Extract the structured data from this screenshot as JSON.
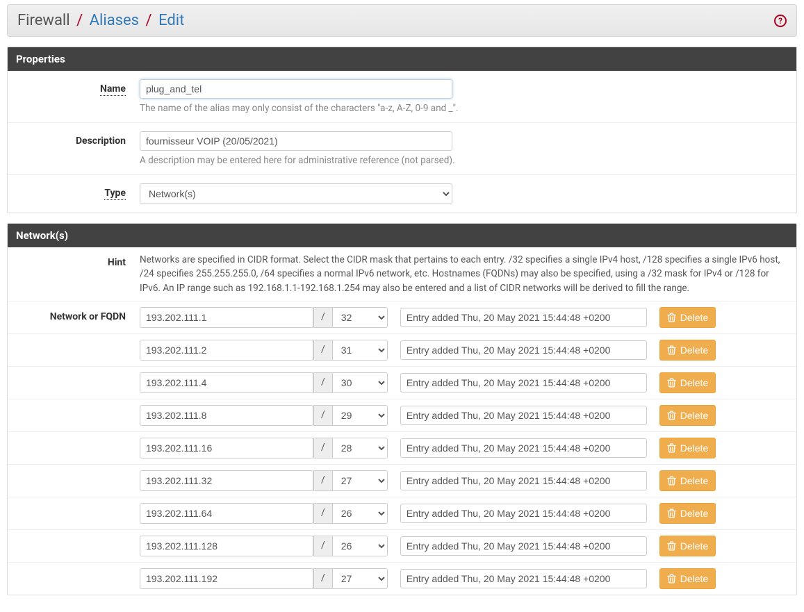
{
  "breadcrumb": {
    "root": "Firewall",
    "link1": "Aliases",
    "link2": "Edit"
  },
  "panels": {
    "properties_title": "Properties",
    "networks_title": "Network(s)"
  },
  "labels": {
    "name": "Name",
    "description": "Description",
    "type": "Type",
    "hint": "Hint",
    "network_or_fqdn": "Network or FQDN",
    "delete": "Delete",
    "slash": "/"
  },
  "fields": {
    "name_value": "plug_and_tel",
    "name_help": "The name of the alias may only consist of the characters \"a-z, A-Z, 0-9 and _\".",
    "description_value": "fournisseur VOIP (20/05/2021)",
    "description_help": "A description may be entered here for administrative reference (not parsed).",
    "type_value": "Network(s)"
  },
  "hint_text": "Networks are specified in CIDR format. Select the CIDR mask that pertains to each entry. /32 specifies a single IPv4 host, /128 specifies a single IPv6 host, /24 specifies 255.255.255.0, /64 specifies a normal IPv6 network, etc. Hostnames (FQDNs) may also be specified, using a /32 mask for IPv4 or /128 for IPv6. An IP range such as 192.168.1.1-192.168.1.254 may also be entered and a list of CIDR networks will be derived to fill the range.",
  "entries": [
    {
      "ip": "193.202.111.1",
      "cidr": "32",
      "note": "Entry added Thu, 20 May 2021 15:44:48 +0200"
    },
    {
      "ip": "193.202.111.2",
      "cidr": "31",
      "note": "Entry added Thu, 20 May 2021 15:44:48 +0200"
    },
    {
      "ip": "193.202.111.4",
      "cidr": "30",
      "note": "Entry added Thu, 20 May 2021 15:44:48 +0200"
    },
    {
      "ip": "193.202.111.8",
      "cidr": "29",
      "note": "Entry added Thu, 20 May 2021 15:44:48 +0200"
    },
    {
      "ip": "193.202.111.16",
      "cidr": "28",
      "note": "Entry added Thu, 20 May 2021 15:44:48 +0200"
    },
    {
      "ip": "193.202.111.32",
      "cidr": "27",
      "note": "Entry added Thu, 20 May 2021 15:44:48 +0200"
    },
    {
      "ip": "193.202.111.64",
      "cidr": "26",
      "note": "Entry added Thu, 20 May 2021 15:44:48 +0200"
    },
    {
      "ip": "193.202.111.128",
      "cidr": "26",
      "note": "Entry added Thu, 20 May 2021 15:44:48 +0200"
    },
    {
      "ip": "193.202.111.192",
      "cidr": "27",
      "note": "Entry added Thu, 20 May 2021 15:44:48 +0200"
    }
  ]
}
